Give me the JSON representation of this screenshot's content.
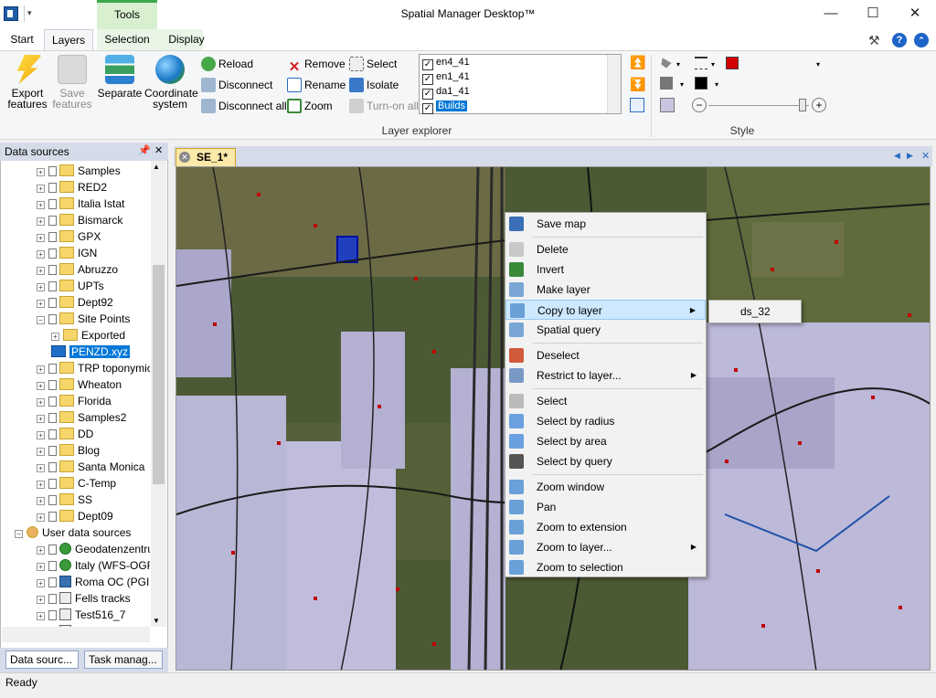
{
  "window": {
    "title": "Spatial Manager Desktop™",
    "min": "—",
    "max": "☐",
    "close": "✕"
  },
  "context_tab": "Tools",
  "tabs": [
    "Start",
    "Layers",
    "Selection",
    "Display"
  ],
  "ribbon": {
    "export": "Export features",
    "save": "Save features",
    "separate": "Separate",
    "coord": "Coordinate system",
    "reload": "Reload",
    "disconnect": "Disconnect",
    "disconnect_all": "Disconnect all",
    "remove": "Remove",
    "rename": "Rename",
    "zoom": "Zoom",
    "select": "Select",
    "isolate": "Isolate",
    "turn_on_all": "Turn-on all",
    "group_layer_explorer": "Layer explorer",
    "group_style": "Style",
    "layers": [
      {
        "name": "en4_41",
        "checked": true
      },
      {
        "name": "en1_41",
        "checked": true
      },
      {
        "name": "da1_41",
        "checked": true
      },
      {
        "name": "Builds",
        "checked": true
      }
    ],
    "fill_color": "#d40000",
    "line_color": "#000000",
    "back_color": "#c9c4df"
  },
  "panel": {
    "title": "Data sources",
    "pin": "📌",
    "close": "✕",
    "items": [
      {
        "label": "Samples",
        "type": "folder",
        "level": 1
      },
      {
        "label": "RED2",
        "type": "folder",
        "level": 1
      },
      {
        "label": "Italia Istat",
        "type": "folder",
        "level": 1
      },
      {
        "label": "Bismarck",
        "type": "folder",
        "level": 1
      },
      {
        "label": "GPX",
        "type": "folder",
        "level": 1
      },
      {
        "label": "IGN",
        "type": "folder",
        "level": 1
      },
      {
        "label": "Abruzzo",
        "type": "folder",
        "level": 1
      },
      {
        "label": "UPTs",
        "type": "folder",
        "level": 1
      },
      {
        "label": "Dept92",
        "type": "folder",
        "level": 1
      },
      {
        "label": "Site Points",
        "type": "folder-open",
        "level": 1
      },
      {
        "label": "Exported",
        "type": "folder",
        "level": 2
      },
      {
        "label": "PENZD.xyz",
        "type": "file",
        "level": 2,
        "selected": true
      },
      {
        "label": "TRP toponymic",
        "type": "folder",
        "level": 1
      },
      {
        "label": "Wheaton",
        "type": "folder",
        "level": 1
      },
      {
        "label": "Florida",
        "type": "folder",
        "level": 1
      },
      {
        "label": "Samples2",
        "type": "folder",
        "level": 1
      },
      {
        "label": "DD",
        "type": "folder",
        "level": 1
      },
      {
        "label": "Blog",
        "type": "folder",
        "level": 1
      },
      {
        "label": "Santa Monica",
        "type": "folder",
        "level": 1
      },
      {
        "label": "C-Temp",
        "type": "folder",
        "level": 1
      },
      {
        "label": "SS",
        "type": "folder",
        "level": 1
      },
      {
        "label": "Dept09",
        "type": "folder",
        "level": 1
      },
      {
        "label": "User data sources",
        "type": "user",
        "level": 0
      },
      {
        "label": "Geodatenzentrum",
        "type": "wms",
        "level": 1
      },
      {
        "label": "Italy (WFS-OGR)",
        "type": "wfs",
        "level": 1
      },
      {
        "label": "Roma OC (PGIS)",
        "type": "pg",
        "level": 1
      },
      {
        "label": "Fells tracks",
        "type": "gpx",
        "level": 1
      },
      {
        "label": "Test516_7",
        "type": "gpx",
        "level": 1
      },
      {
        "label": "SQL_OC_Admin F",
        "type": "gpx",
        "level": 1
      }
    ],
    "bottom_tabs": [
      "Data sourc...",
      "Task manag..."
    ]
  },
  "doc_tab": "SE_1*",
  "context_menu": [
    {
      "label": "Save map",
      "icon": "save-map-icon",
      "color": "#3b6fb6"
    },
    {
      "sep": true
    },
    {
      "label": "Delete",
      "icon": "eraser-icon",
      "color": "#c8c8c8"
    },
    {
      "label": "Invert",
      "icon": "invert-icon",
      "color": "#3a8a3a"
    },
    {
      "label": "Make layer",
      "icon": "make-layer-icon",
      "color": "#7aa6d6"
    },
    {
      "label": "Copy to layer",
      "icon": "copy-layer-icon",
      "color": "#6aa0d8",
      "submenu": true,
      "highlight": true
    },
    {
      "label": "Spatial query",
      "icon": "spatial-query-icon",
      "color": "#7aa6d6"
    },
    {
      "sep": true
    },
    {
      "label": "Deselect",
      "icon": "deselect-icon",
      "color": "#d05a3a"
    },
    {
      "label": "Restrict to layer...",
      "icon": "restrict-icon",
      "color": "#7a9ac6",
      "submenu": true
    },
    {
      "sep": true
    },
    {
      "label": "Select",
      "icon": "select-cursor-icon",
      "color": "#bbbbbb"
    },
    {
      "label": "Select by radius",
      "icon": "radius-icon",
      "color": "#6aa0e0"
    },
    {
      "label": "Select by area",
      "icon": "area-icon",
      "color": "#6aa0e0"
    },
    {
      "label": "Select by query",
      "icon": "binoculars-icon",
      "color": "#555555"
    },
    {
      "sep": true
    },
    {
      "label": "Zoom window",
      "icon": "zoom-window-icon",
      "color": "#6aa0d8"
    },
    {
      "label": "Pan",
      "icon": "pan-icon",
      "color": "#6aa0d8"
    },
    {
      "label": "Zoom to extension",
      "icon": "zoom-ext-icon",
      "color": "#6aa0d8"
    },
    {
      "label": "Zoom to layer...",
      "icon": "zoom-layer-icon",
      "color": "#6aa0d8",
      "submenu": true
    },
    {
      "label": "Zoom to selection",
      "icon": "zoom-sel-icon",
      "color": "#6aa0d8"
    }
  ],
  "submenu_item": "ds_32",
  "status": "Ready"
}
